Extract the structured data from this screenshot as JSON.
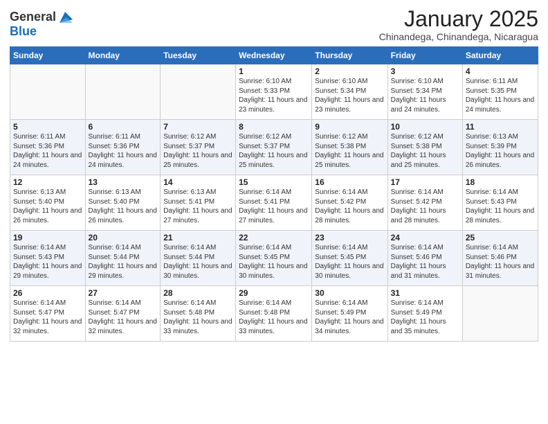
{
  "header": {
    "logo_general": "General",
    "logo_blue": "Blue",
    "month": "January 2025",
    "location": "Chinandega, Chinandega, Nicaragua"
  },
  "weekdays": [
    "Sunday",
    "Monday",
    "Tuesday",
    "Wednesday",
    "Thursday",
    "Friday",
    "Saturday"
  ],
  "weeks": [
    [
      {
        "day": "",
        "info": ""
      },
      {
        "day": "",
        "info": ""
      },
      {
        "day": "",
        "info": ""
      },
      {
        "day": "1",
        "info": "Sunrise: 6:10 AM\nSunset: 5:33 PM\nDaylight: 11 hours and 23 minutes."
      },
      {
        "day": "2",
        "info": "Sunrise: 6:10 AM\nSunset: 5:34 PM\nDaylight: 11 hours and 23 minutes."
      },
      {
        "day": "3",
        "info": "Sunrise: 6:10 AM\nSunset: 5:34 PM\nDaylight: 11 hours and 24 minutes."
      },
      {
        "day": "4",
        "info": "Sunrise: 6:11 AM\nSunset: 5:35 PM\nDaylight: 11 hours and 24 minutes."
      }
    ],
    [
      {
        "day": "5",
        "info": "Sunrise: 6:11 AM\nSunset: 5:36 PM\nDaylight: 11 hours and 24 minutes."
      },
      {
        "day": "6",
        "info": "Sunrise: 6:11 AM\nSunset: 5:36 PM\nDaylight: 11 hours and 24 minutes."
      },
      {
        "day": "7",
        "info": "Sunrise: 6:12 AM\nSunset: 5:37 PM\nDaylight: 11 hours and 25 minutes."
      },
      {
        "day": "8",
        "info": "Sunrise: 6:12 AM\nSunset: 5:37 PM\nDaylight: 11 hours and 25 minutes."
      },
      {
        "day": "9",
        "info": "Sunrise: 6:12 AM\nSunset: 5:38 PM\nDaylight: 11 hours and 25 minutes."
      },
      {
        "day": "10",
        "info": "Sunrise: 6:12 AM\nSunset: 5:38 PM\nDaylight: 11 hours and 25 minutes."
      },
      {
        "day": "11",
        "info": "Sunrise: 6:13 AM\nSunset: 5:39 PM\nDaylight: 11 hours and 26 minutes."
      }
    ],
    [
      {
        "day": "12",
        "info": "Sunrise: 6:13 AM\nSunset: 5:40 PM\nDaylight: 11 hours and 26 minutes."
      },
      {
        "day": "13",
        "info": "Sunrise: 6:13 AM\nSunset: 5:40 PM\nDaylight: 11 hours and 26 minutes."
      },
      {
        "day": "14",
        "info": "Sunrise: 6:13 AM\nSunset: 5:41 PM\nDaylight: 11 hours and 27 minutes."
      },
      {
        "day": "15",
        "info": "Sunrise: 6:14 AM\nSunset: 5:41 PM\nDaylight: 11 hours and 27 minutes."
      },
      {
        "day": "16",
        "info": "Sunrise: 6:14 AM\nSunset: 5:42 PM\nDaylight: 11 hours and 28 minutes."
      },
      {
        "day": "17",
        "info": "Sunrise: 6:14 AM\nSunset: 5:42 PM\nDaylight: 11 hours and 28 minutes."
      },
      {
        "day": "18",
        "info": "Sunrise: 6:14 AM\nSunset: 5:43 PM\nDaylight: 11 hours and 28 minutes."
      }
    ],
    [
      {
        "day": "19",
        "info": "Sunrise: 6:14 AM\nSunset: 5:43 PM\nDaylight: 11 hours and 29 minutes."
      },
      {
        "day": "20",
        "info": "Sunrise: 6:14 AM\nSunset: 5:44 PM\nDaylight: 11 hours and 29 minutes."
      },
      {
        "day": "21",
        "info": "Sunrise: 6:14 AM\nSunset: 5:44 PM\nDaylight: 11 hours and 30 minutes."
      },
      {
        "day": "22",
        "info": "Sunrise: 6:14 AM\nSunset: 5:45 PM\nDaylight: 11 hours and 30 minutes."
      },
      {
        "day": "23",
        "info": "Sunrise: 6:14 AM\nSunset: 5:45 PM\nDaylight: 11 hours and 30 minutes."
      },
      {
        "day": "24",
        "info": "Sunrise: 6:14 AM\nSunset: 5:46 PM\nDaylight: 11 hours and 31 minutes."
      },
      {
        "day": "25",
        "info": "Sunrise: 6:14 AM\nSunset: 5:46 PM\nDaylight: 11 hours and 31 minutes."
      }
    ],
    [
      {
        "day": "26",
        "info": "Sunrise: 6:14 AM\nSunset: 5:47 PM\nDaylight: 11 hours and 32 minutes."
      },
      {
        "day": "27",
        "info": "Sunrise: 6:14 AM\nSunset: 5:47 PM\nDaylight: 11 hours and 32 minutes."
      },
      {
        "day": "28",
        "info": "Sunrise: 6:14 AM\nSunset: 5:48 PM\nDaylight: 11 hours and 33 minutes."
      },
      {
        "day": "29",
        "info": "Sunrise: 6:14 AM\nSunset: 5:48 PM\nDaylight: 11 hours and 33 minutes."
      },
      {
        "day": "30",
        "info": "Sunrise: 6:14 AM\nSunset: 5:49 PM\nDaylight: 11 hours and 34 minutes."
      },
      {
        "day": "31",
        "info": "Sunrise: 6:14 AM\nSunset: 5:49 PM\nDaylight: 11 hours and 35 minutes."
      },
      {
        "day": "",
        "info": ""
      }
    ]
  ]
}
